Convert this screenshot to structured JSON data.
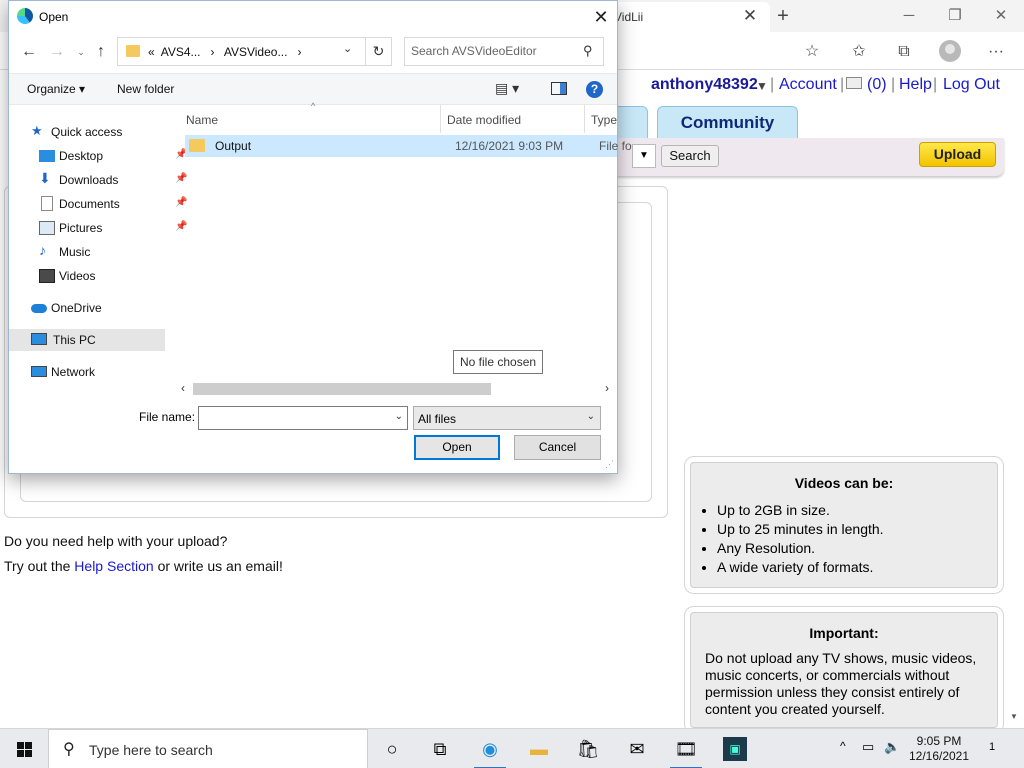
{
  "browser": {
    "tab_title": "VidLii",
    "new_tab": "+",
    "controls": {
      "minimize": "─",
      "maximize": "❐",
      "close": "✕"
    },
    "tab_close": "✕",
    "more": "···"
  },
  "site": {
    "header": {
      "username": "anthony48392",
      "dropdown": "▼",
      "account": "Account",
      "sep": "|",
      "inbox_count": "(0)",
      "help": "Help",
      "logout": "Log Out"
    },
    "community_tab": "Community",
    "search_button": "Search",
    "upload_button": "Upload",
    "help_text": {
      "question": "Do you need help with your upload?",
      "try": "Try out the",
      "help_link": "Help Section",
      "rest": "or write us an email!"
    },
    "videos_box": {
      "title": "Videos can be:",
      "items": [
        "Up to 2GB in size.",
        "Up to 25 minutes in length.",
        "Any Resolution.",
        "A wide variety of formats."
      ]
    },
    "important_box": {
      "title": "Important:",
      "text": "Do not upload any TV shows, music videos, music concerts, or commercials without permission unless they consist entirely of content you created yourself."
    }
  },
  "dialog": {
    "title": "Open",
    "breadcrumb": {
      "prefix": "«",
      "part1": "AVS4...",
      "sep": "›",
      "part2": "AVSVideo...",
      "dropdown": "⌄"
    },
    "search_placeholder": "Search AVSVideoEditor",
    "organize": "Organize ▾",
    "new_folder": "New folder",
    "view_icon": "▤ ▾",
    "help": "?",
    "nav": {
      "quick_access": "Quick access",
      "desktop": "Desktop",
      "downloads": "Downloads",
      "documents": "Documents",
      "pictures": "Pictures",
      "music": "Music",
      "videos": "Videos",
      "onedrive": "OneDrive",
      "this_pc": "This PC",
      "network": "Network"
    },
    "columns": {
      "name": "Name",
      "date": "Date modified",
      "type": "Type"
    },
    "files": [
      {
        "name": "Output",
        "date": "12/16/2021 9:03 PM",
        "type": "File fo"
      }
    ],
    "tooltip": "No file chosen",
    "filename_label": "File name:",
    "filename_value": "",
    "filetype": "All files",
    "open_button": "Open",
    "cancel_button": "Cancel"
  },
  "taskbar": {
    "search_placeholder": "Type here to search",
    "time": "9:05 PM",
    "date": "12/16/2021",
    "notifications": "1"
  },
  "colors": {
    "accent": "#0078d7",
    "link": "#1a1acc",
    "upload": "#f2c400",
    "community_tab": "#c8e8f8",
    "selection": "#cce8ff"
  }
}
